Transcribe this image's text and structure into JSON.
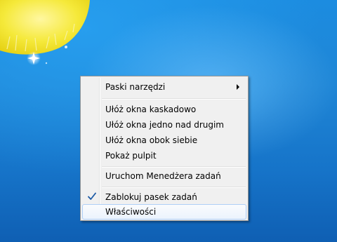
{
  "context_menu": {
    "items": [
      {
        "label": "Paski narzędzi",
        "has_submenu": true
      },
      {
        "label": "Ułóż okna kaskadowo"
      },
      {
        "label": "Ułóż okna jedno nad drugim"
      },
      {
        "label": "Ułóż okna obok siebie"
      },
      {
        "label": "Pokaż pulpit"
      },
      {
        "label": "Uruchom Menedżera zadań"
      },
      {
        "label": "Zablokuj pasek zadań",
        "checked": true
      },
      {
        "label": "Właściwości",
        "highlighted": true
      }
    ]
  },
  "colors": {
    "desktop_blue": "#1f86d6",
    "menu_background": "#f0f0f0",
    "highlight_border": "#aecff7",
    "check_blue": "#1c5aa5"
  }
}
